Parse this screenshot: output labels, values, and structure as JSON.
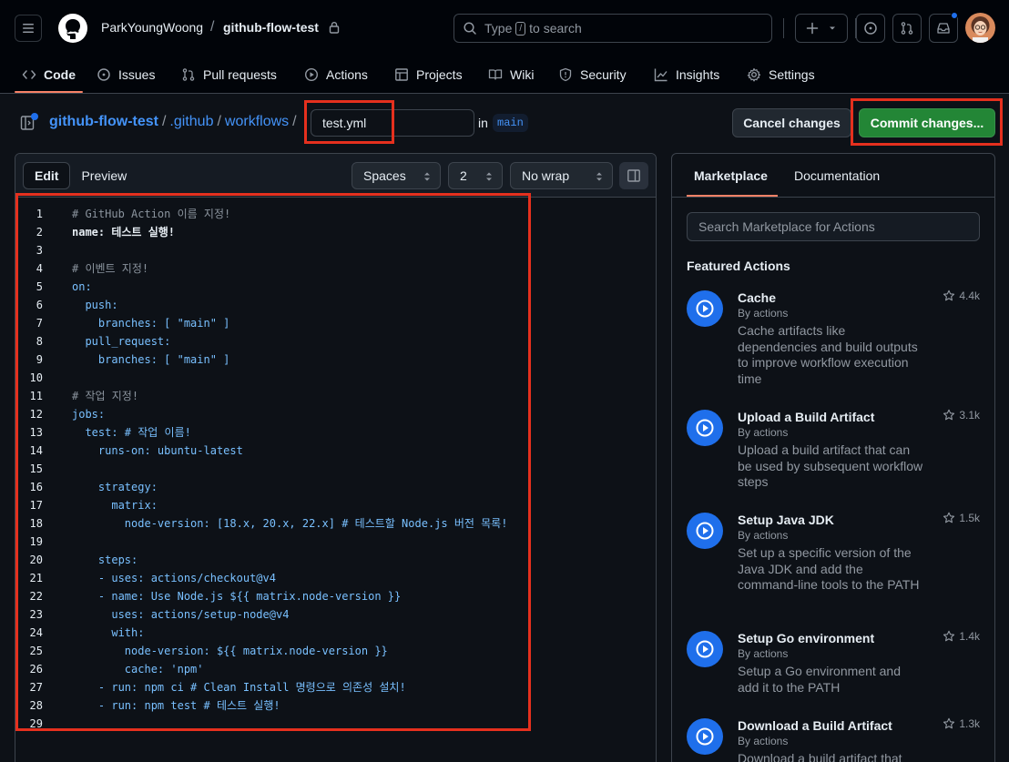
{
  "header": {
    "owner": "ParkYoungWoong",
    "separator": "/",
    "repo": "github-flow-test",
    "search_prefix": "Type",
    "search_key": "/",
    "search_suffix": "to search"
  },
  "repo_nav": {
    "items": [
      {
        "label": "Code",
        "icon": "code-icon"
      },
      {
        "label": "Issues",
        "icon": "issue-icon"
      },
      {
        "label": "Pull requests",
        "icon": "pull-request-icon"
      },
      {
        "label": "Actions",
        "icon": "play-icon"
      },
      {
        "label": "Projects",
        "icon": "table-icon"
      },
      {
        "label": "Wiki",
        "icon": "book-icon"
      },
      {
        "label": "Security",
        "icon": "shield-icon"
      },
      {
        "label": "Insights",
        "icon": "graph-icon"
      },
      {
        "label": "Settings",
        "icon": "gear-icon"
      }
    ]
  },
  "path": {
    "repo": "github-flow-test",
    "sep": "/",
    "dir1": ".github",
    "dir2": "workflows",
    "filename": "test.yml",
    "in_label": "in",
    "branch": "main"
  },
  "actions": {
    "cancel": "Cancel changes",
    "commit": "Commit changes..."
  },
  "editor": {
    "tab_edit": "Edit",
    "tab_preview": "Preview",
    "indent_mode": "Spaces",
    "indent_size": "2",
    "wrap_mode": "No wrap",
    "line_numbers": [
      "1",
      "2",
      "3",
      "4",
      "5",
      "6",
      "7",
      "8",
      "9",
      "10",
      "11",
      "12",
      "13",
      "14",
      "15",
      "16",
      "17",
      "18",
      "19",
      "20",
      "21",
      "22",
      "23",
      "24",
      "25",
      "26",
      "27",
      "28",
      "29"
    ],
    "lines": [
      "# GitHub Action 이름 지정!",
      "name: 테스트 실행!",
      "",
      "# 이벤트 지정!",
      "on:",
      "  push:",
      "    branches: [ \"main\" ]",
      "  pull_request:",
      "    branches: [ \"main\" ]",
      "",
      "# 작업 지정!",
      "jobs:",
      "  test: # 작업 이름!",
      "    runs-on: ubuntu-latest",
      "",
      "    strategy:",
      "      matrix:",
      "        node-version: [18.x, 20.x, 22.x] # 테스트할 Node.js 버전 목록!",
      "",
      "    steps:",
      "    - uses: actions/checkout@v4",
      "    - name: Use Node.js ${{ matrix.node-version }}",
      "      uses: actions/setup-node@v4",
      "      with:",
      "        node-version: ${{ matrix.node-version }}",
      "        cache: 'npm'",
      "    - run: npm ci # Clean Install 명령으로 의존성 설치!",
      "    - run: npm test # 테스트 실행!",
      ""
    ]
  },
  "marketplace": {
    "tab_marketplace": "Marketplace",
    "tab_documentation": "Documentation",
    "search_placeholder": "Search Marketplace for Actions",
    "featured_heading": "Featured Actions",
    "items": [
      {
        "name": "Cache",
        "by": "By actions",
        "desc": "Cache artifacts like dependencies and build outputs to improve workflow execution time",
        "stars": "4.4k"
      },
      {
        "name": "Upload a Build Artifact",
        "by": "By actions",
        "desc": "Upload a build artifact that can be used by subsequent workflow steps",
        "stars": "3.1k"
      },
      {
        "name": "Setup Java JDK",
        "by": "By actions",
        "desc": "Set up a specific version of the Java JDK and add the command-line tools to the PATH",
        "stars": "1.5k"
      },
      {
        "name": "Setup Go environment",
        "by": "By actions",
        "desc": "Setup a Go environment and add it to the PATH",
        "stars": "1.4k"
      },
      {
        "name": "Download a Build Artifact",
        "by": "By actions",
        "desc": "Download a build artifact that",
        "stars": "1.3k"
      }
    ]
  },
  "colors": {
    "accent_link": "#4493f8",
    "commit_green": "#238636",
    "highlight_red": "#e5301e",
    "nav_underline": "#f78166"
  }
}
